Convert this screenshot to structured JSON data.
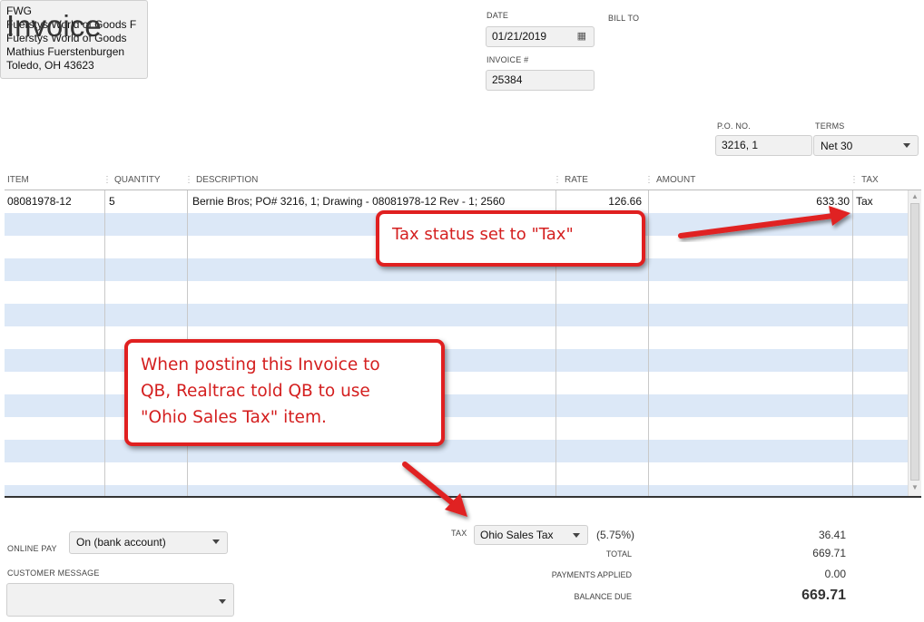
{
  "header": {
    "title": "Invoice",
    "date_label": "DATE",
    "date_value": "01/21/2019",
    "invoice_label": "INVOICE #",
    "invoice_value": "25384",
    "bill_to_label": "BILL TO",
    "bill_to_lines": [
      "FWG",
      "Fuerstys World of Goods F",
      "Fuerstys World of Goods",
      "Mathius Fuerstenburgen",
      "Toledo, OH 43623"
    ],
    "po_label": "P.O. NO.",
    "po_value": "3216, 1",
    "terms_label": "TERMS",
    "terms_value": "Net 30"
  },
  "table": {
    "columns": [
      "ITEM",
      "QUANTITY",
      "DESCRIPTION",
      "RATE",
      "AMOUNT",
      "TAX"
    ],
    "rows": [
      {
        "item": "08081978-12",
        "quantity": "5",
        "description": "Bernie Bros; PO# 3216, 1; Drawing - 08081978-12 Rev - 1; 2560",
        "rate": "126.66",
        "amount": "633.30",
        "tax": "Tax"
      }
    ]
  },
  "callouts": {
    "tax_status": "Tax status set to \"Tax\"",
    "posting_line1": "When posting this Invoice to",
    "posting_line2": "QB, Realtrac told QB to use",
    "posting_line3": "\"Ohio Sales Tax\" item."
  },
  "footer": {
    "online_pay_label": "ONLINE PAY",
    "online_pay_value": "On (bank account)",
    "customer_message_label": "CUSTOMER MESSAGE",
    "customer_message_value": "",
    "tax_label": "TAX",
    "tax_item": "Ohio Sales Tax",
    "tax_rate": "(5.75%)",
    "tax_amount": "36.41",
    "total_label": "TOTAL",
    "total_value": "669.71",
    "payments_label": "PAYMENTS APPLIED",
    "payments_value": "0.00",
    "balance_label": "BALANCE DUE",
    "balance_value": "669.71"
  },
  "colors": {
    "row_alt": "#dce8f7",
    "callout_red": "#e02020"
  },
  "icons": [
    "calendar-icon",
    "chevron-down-icon",
    "scroll-up-icon",
    "scroll-down-icon",
    "arrow-icon"
  ]
}
